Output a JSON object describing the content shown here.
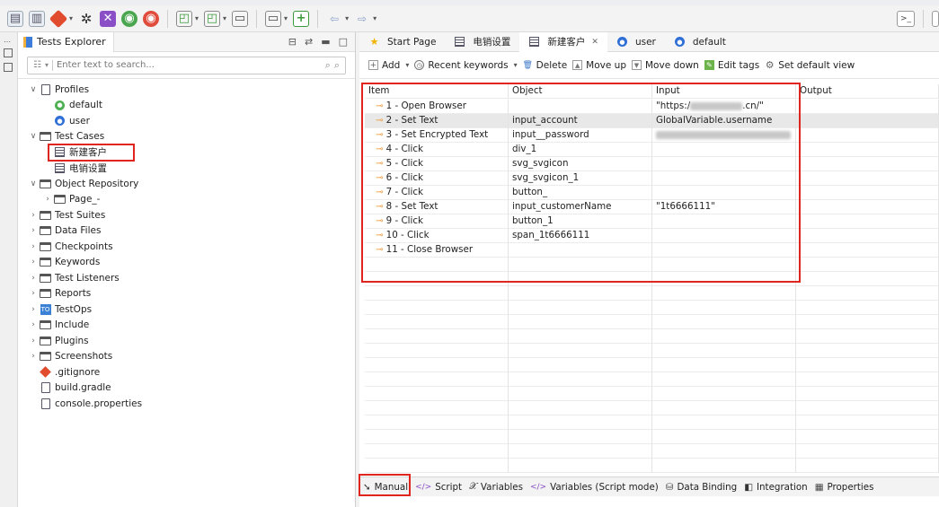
{
  "explorer": {
    "title": "Tests Explorer",
    "search_placeholder": "Enter text to search..."
  },
  "tree": [
    {
      "label": "Profiles",
      "level": 0,
      "chev": "down",
      "icon": "doc"
    },
    {
      "label": "default",
      "level": 1,
      "chev": "",
      "icon": "gprof"
    },
    {
      "label": "user",
      "level": 1,
      "chev": "",
      "icon": "bprof"
    },
    {
      "label": "Test Cases",
      "level": 0,
      "chev": "down",
      "icon": "folder"
    },
    {
      "label": "新建客户",
      "level": 1,
      "chev": "",
      "icon": "grid",
      "highlight": true
    },
    {
      "label": "电销设置",
      "level": 1,
      "chev": "",
      "icon": "grid"
    },
    {
      "label": "Object Repository",
      "level": 0,
      "chev": "down",
      "icon": "folder"
    },
    {
      "label": "Page_-",
      "level": 1,
      "chev": "right",
      "icon": "folder"
    },
    {
      "label": "Test Suites",
      "level": 0,
      "chev": "right",
      "icon": "folder"
    },
    {
      "label": "Data Files",
      "level": 0,
      "chev": "right",
      "icon": "folder"
    },
    {
      "label": "Checkpoints",
      "level": 0,
      "chev": "right",
      "icon": "folder"
    },
    {
      "label": "Keywords",
      "level": 0,
      "chev": "right",
      "icon": "folder"
    },
    {
      "label": "Test Listeners",
      "level": 0,
      "chev": "right",
      "icon": "folder"
    },
    {
      "label": "Reports",
      "level": 0,
      "chev": "right",
      "icon": "folder"
    },
    {
      "label": "TestOps",
      "level": 0,
      "chev": "right",
      "icon": "testops"
    },
    {
      "label": "Include",
      "level": 0,
      "chev": "right",
      "icon": "folder"
    },
    {
      "label": "Plugins",
      "level": 0,
      "chev": "right",
      "icon": "folder"
    },
    {
      "label": "Screenshots",
      "level": 0,
      "chev": "right",
      "icon": "folder"
    },
    {
      "label": ".gitignore",
      "level": 0,
      "chev": "",
      "icon": "git"
    },
    {
      "label": "build.gradle",
      "level": 0,
      "chev": "",
      "icon": "doc"
    },
    {
      "label": "console.properties",
      "level": 0,
      "chev": "",
      "icon": "doc"
    }
  ],
  "editor_tabs": [
    {
      "label": "Start Page",
      "icon": "star"
    },
    {
      "label": "电销设置",
      "icon": "grid"
    },
    {
      "label": "新建客户",
      "icon": "grid",
      "active": true,
      "closable": true
    },
    {
      "label": "user",
      "icon": "bprof"
    },
    {
      "label": "default",
      "icon": "bprof"
    }
  ],
  "editor_toolbar": {
    "add": "Add",
    "recent_keywords": "Recent keywords",
    "delete": "Delete",
    "move_up": "Move up",
    "move_down": "Move down",
    "edit_tags": "Edit tags",
    "set_default_view": "Set default view"
  },
  "columns": {
    "item": "Item",
    "object": "Object",
    "input": "Input",
    "output": "Output"
  },
  "steps": [
    {
      "item": "1 - Open Browser",
      "object": "",
      "input_prefix": "\"https:/",
      "input_suffix": ".cn/\"",
      "input_blur": true
    },
    {
      "item": "2 - Set Text",
      "object": "input_account",
      "input": "GlobalVariable.username",
      "selected": true
    },
    {
      "item": "3 - Set Encrypted Text",
      "object": "input__password",
      "input_masked": true
    },
    {
      "item": "4 - Click",
      "object": "div_1",
      "input": ""
    },
    {
      "item": "5 - Click",
      "object": "svg_svgicon",
      "input": ""
    },
    {
      "item": "6 - Click",
      "object": "svg_svgicon_1",
      "input": ""
    },
    {
      "item": "7 - Click",
      "object": "button_",
      "input": ""
    },
    {
      "item": "8 - Set Text",
      "object": "input_customerName",
      "input": "\"1t6666111\""
    },
    {
      "item": "9 - Click",
      "object": "button_1",
      "input": ""
    },
    {
      "item": "10 - Click",
      "object": "span_1t6666111",
      "input": ""
    },
    {
      "item": "11 - Close Browser",
      "object": "",
      "input": ""
    }
  ],
  "bottom_tabs": [
    "Manual",
    "Script",
    "Variables",
    "Variables (Script mode)",
    "Data Binding",
    "Integration",
    "Properties"
  ],
  "colors": {
    "highlight_border": "#e0241e",
    "accent_orange": "#f0a042",
    "row_selected": "#e8e8e8"
  }
}
